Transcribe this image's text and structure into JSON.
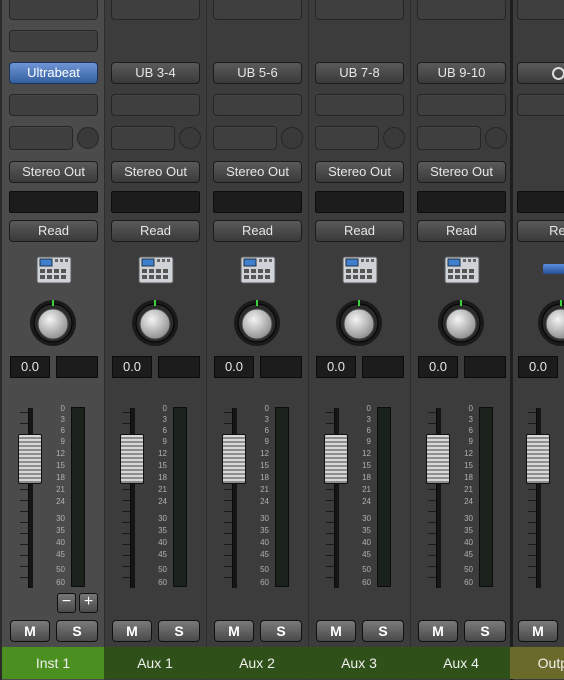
{
  "channels": [
    {
      "name": "Inst 1",
      "input_label": "Ultrabeat",
      "input_highlight": true,
      "output": "Stereo Out",
      "automation": "Read",
      "pan_value": "0.0",
      "mute": "M",
      "solo": "S"
    },
    {
      "name": "Aux 1",
      "input_label": "UB 3-4",
      "input_highlight": false,
      "output": "Stereo Out",
      "automation": "Read",
      "pan_value": "0.0",
      "mute": "M",
      "solo": "S"
    },
    {
      "name": "Aux 2",
      "input_label": "UB 5-6",
      "input_highlight": false,
      "output": "Stereo Out",
      "automation": "Read",
      "pan_value": "0.0",
      "mute": "M",
      "solo": "S"
    },
    {
      "name": "Aux 3",
      "input_label": "UB 7-8",
      "input_highlight": false,
      "output": "Stereo Out",
      "automation": "Read",
      "pan_value": "0.0",
      "mute": "M",
      "solo": "S"
    },
    {
      "name": "Aux 4",
      "input_label": "UB 9-10",
      "input_highlight": false,
      "output": "Stereo Out",
      "automation": "Read",
      "pan_value": "0.0",
      "mute": "M",
      "solo": "S"
    }
  ],
  "output_channel": {
    "name": "Outp",
    "automation": "Rea",
    "pan_value": "0.0",
    "mute": "M"
  },
  "meter_scale": [
    "0",
    "3",
    "6",
    "9",
    "12",
    "15",
    "18",
    "21",
    "24",
    "30",
    "35",
    "40",
    "45",
    "50",
    "60"
  ],
  "group_controls": {
    "minus": "−",
    "plus": "+"
  },
  "colors": {
    "instrument_name_bg": "#4a8f20",
    "aux_name_bg": "#2f5119",
    "output_name_bg": "#6a6a2a",
    "selected_input": "#4a76c0",
    "strip_bg": "#3c3c3c"
  },
  "icons": {
    "channel_icon": "drum-machine-icon",
    "pan_knob": "pan-knob-icon"
  }
}
